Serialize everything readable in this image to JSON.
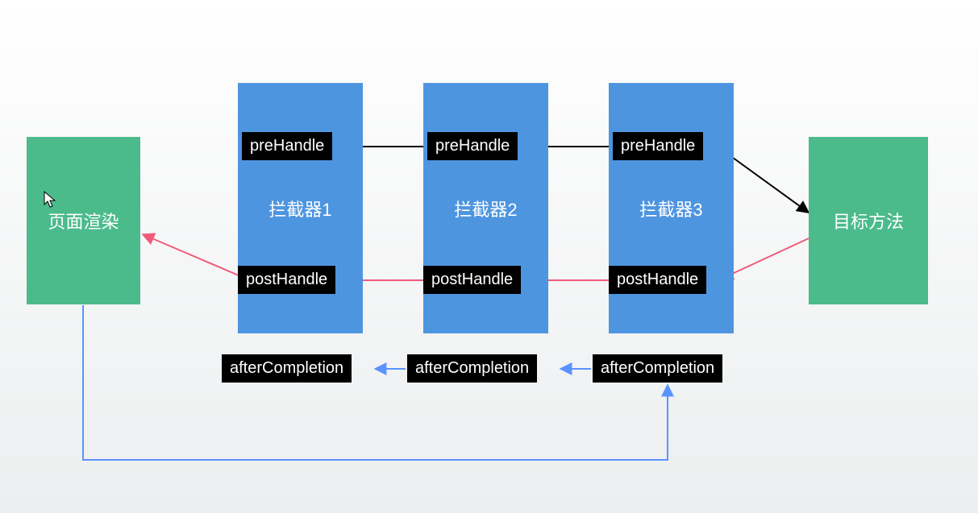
{
  "left_box": {
    "label": "页面渲染"
  },
  "right_box": {
    "label": "目标方法"
  },
  "columns": [
    {
      "title": "拦截器1",
      "pre": "preHandle",
      "post": "postHandle",
      "after": "afterCompletion"
    },
    {
      "title": "拦截器2",
      "pre": "preHandle",
      "post": "postHandle",
      "after": "afterCompletion"
    },
    {
      "title": "拦截器3",
      "pre": "preHandle",
      "post": "postHandle",
      "after": "afterCompletion"
    }
  ],
  "colors": {
    "column": "#4e95e0",
    "endbox": "#4bbb8b",
    "pill_bg": "#000000",
    "text": "#ffffff",
    "arrow_black": "#000000",
    "arrow_red": "#f05a7a",
    "arrow_blue": "#5a93ff"
  }
}
